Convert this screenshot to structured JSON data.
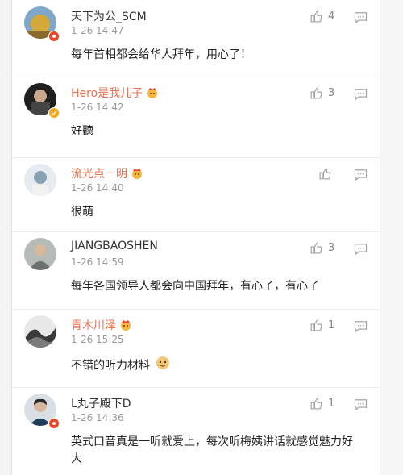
{
  "comments": [
    {
      "username": "天下为公_SCM",
      "time": "1-26 14:47",
      "text": "每年首相都会给华人拜年，用心了！",
      "likes": "4",
      "badge": "red",
      "vip": false,
      "orange": false,
      "avatar_color": "#c9a13b"
    },
    {
      "username": "Hero是我儿子",
      "time": "1-26 14:42",
      "text": "好聽",
      "likes": "3",
      "badge": "gold",
      "vip": true,
      "orange": true,
      "avatar_color": "#2b2b2b"
    },
    {
      "username": "流光点一明",
      "time": "1-26 14:40",
      "text": "很萌",
      "likes": "",
      "badge": "",
      "vip": true,
      "orange": true,
      "avatar_color": "#d7dbe0"
    },
    {
      "username": "JIANGBAOSHEN",
      "time": "1-26 14:59",
      "text": "每年各国领导人都会向中国拜年，有心了，有心了",
      "likes": "3",
      "badge": "",
      "vip": false,
      "orange": false,
      "avatar_color": "#9a9d9a"
    },
    {
      "username": "青木川泽",
      "time": "1-26 15:25",
      "text": "不错的听力材料",
      "likes": "1",
      "badge": "",
      "vip": true,
      "orange": true,
      "avatar_color": "#555555",
      "emoji": true
    },
    {
      "username": "L丸子殿下D",
      "time": "1-26 14:36",
      "text": "英式口音真是一听就爱上，每次听梅姨讲话就感觉魅力好大",
      "likes": "1",
      "badge": "red",
      "vip": false,
      "orange": false,
      "avatar_color": "#3d5a6b"
    }
  ],
  "colors": {
    "name_orange": "#eb7350",
    "meta_gray": "#999999",
    "badge_red": "#e8452c",
    "badge_gold": "#f3a81a"
  },
  "icons": {
    "like": "thumbs-up-icon",
    "reply": "comment-icon",
    "vip": "crown-face-icon"
  }
}
